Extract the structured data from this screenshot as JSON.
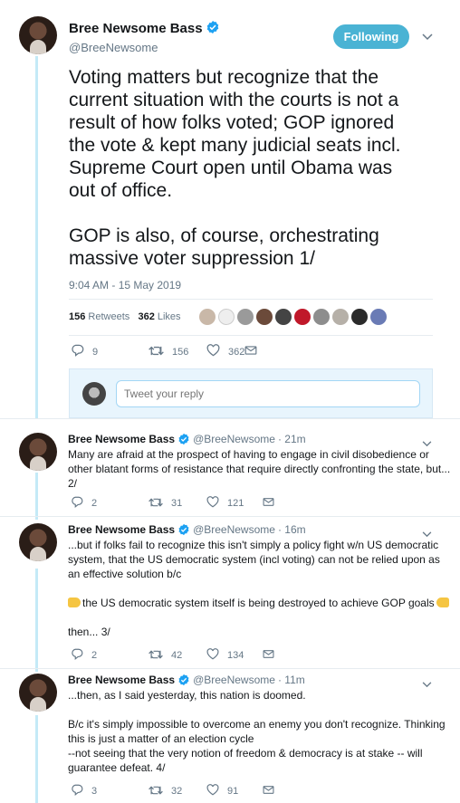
{
  "main_tweet": {
    "author_name": "Bree Newsome Bass",
    "author_handle": "@BreeNewsome",
    "follow_button": "Following",
    "text_lines": [
      "Voting matters but recognize that the",
      "current situation with the courts is not a",
      "result of how folks voted; GOP ignored",
      "the vote & kept many judicial seats incl.",
      "Supreme Court open until Obama was",
      "out of office.",
      "",
      "GOP is also, of course, orchestrating",
      "massive voter suppression 1/"
    ],
    "timestamp": "9:04 AM - 15 May 2019",
    "retweets_count": "156",
    "retweets_label": "Retweets",
    "likes_count": "362",
    "likes_label": "Likes",
    "reply_count": "9",
    "retweet_action_count": "156",
    "like_action_count": "362"
  },
  "reply_box": {
    "placeholder": "Tweet your reply"
  },
  "replies": [
    {
      "author_name": "Bree Newsome Bass",
      "author_handle": "@BreeNewsome",
      "time": "· 21m",
      "paragraphs": [
        [
          "Many are afraid at the prospect of having to engage in civil disobedience or",
          "other blatant forms of resistance that require directly confronting the state, but...",
          "2/"
        ]
      ],
      "reply_count": "2",
      "retweet_count": "31",
      "like_count": "121"
    },
    {
      "author_name": "Bree Newsome Bass",
      "author_handle": "@BreeNewsome",
      "time": "· 16m",
      "paragraphs": [
        [
          "...but if folks fail to recognize this isn't simply a policy fight w/n US democratic",
          "system, that the US democratic system (incl voting) can not be relied upon as",
          "an effective solution b/c"
        ],
        [
          "the US democratic system itself is being destroyed to achieve GOP goals"
        ],
        [
          "then... 3/"
        ]
      ],
      "reply_count": "2",
      "retweet_count": "42",
      "like_count": "134"
    },
    {
      "author_name": "Bree Newsome Bass",
      "author_handle": "@BreeNewsome",
      "time": "· 11m",
      "paragraphs": [
        [
          "...then, as I said yesterday, this nation is doomed."
        ],
        [
          "B/c it's simply impossible to overcome an enemy you don't recognize. Thinking",
          "this is just a matter of an election cycle",
          "--not seeing that the very notion of freedom & democracy is at stake -- will",
          "guarantee defeat. 4/"
        ]
      ],
      "reply_count": "3",
      "retweet_count": "32",
      "like_count": "91"
    }
  ],
  "colors": {
    "accent": "#1da1f2",
    "follow_bg": "#4ab3d4",
    "thread_line": "#c4eaf7",
    "muted": "#657786"
  }
}
